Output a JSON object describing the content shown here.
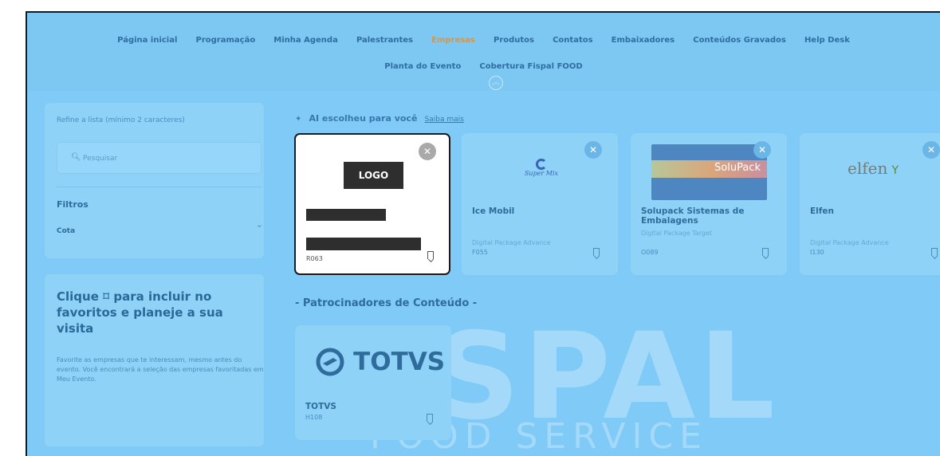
{
  "nav": {
    "row1": [
      "Página inicial",
      "Programação",
      "Minha Agenda",
      "Palestrantes",
      "Empresas",
      "Produtos",
      "Contatos",
      "Embaixadores",
      "Conteúdos Gravados",
      "Help Desk"
    ],
    "row2": [
      "Planta do Evento",
      "Cobertura Fispal FOOD"
    ],
    "active": "Empresas"
  },
  "sidebar": {
    "refine_label": "Refine a lista (mínimo 2 caracteres)",
    "search_placeholder": "Pesquisar",
    "filters_title": "Filtros",
    "filter_cota_label": "Cota",
    "fav_title": "Clique ⌑ para incluir no favoritos e planeje a sua visita",
    "fav_description": "Favorite as empresas que te interessam, mesmo antes do evento. Você encontrará a seleção das empresas favoritadas em Meu Evento."
  },
  "ai": {
    "label": "AI escolheu para você",
    "link": "Saiba mais"
  },
  "cards": [
    {
      "name": "",
      "type": "",
      "code": "R063",
      "logo_text": "LOGO"
    },
    {
      "name": "Ice Mobil",
      "type": "Digital Package Advance",
      "code": "F055",
      "logo_text": "Super Mix"
    },
    {
      "name": "Solupack Sistemas de Embalagens",
      "type": "Digital Package Target",
      "code": "O089",
      "logo_text": "SoluPack"
    },
    {
      "name": "Elfen",
      "type": "Digital Package Advance",
      "code": "I130",
      "logo_text": "elfen"
    }
  ],
  "section_title": "- Patrocinadores de Conteúdo -",
  "sponsor": {
    "name": "TOTVS",
    "code": "H108",
    "logo_text": "TOTVS"
  },
  "watermark": {
    "line1": "SPAL",
    "line2": "FOOD SERVICE"
  },
  "colors": {
    "overlay": "#7fcaf6",
    "accent": "#2f6c9c",
    "active_nav": "#c89a5e"
  }
}
